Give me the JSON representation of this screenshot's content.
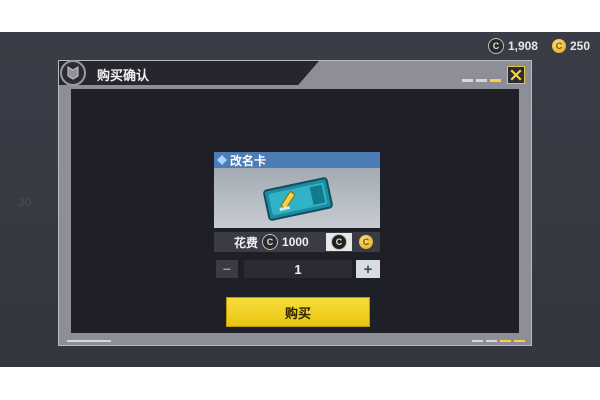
{
  "currency": {
    "cp_amount": "1,908",
    "gold_amount": "250"
  },
  "dialog": {
    "title": "购买确认",
    "item_name": "改名卡",
    "price_label": "花费",
    "price_value": "1000",
    "quantity": "1",
    "buy_label": "购买"
  },
  "background": {
    "ghost_value": "30"
  },
  "icons": {
    "cp_coin": "C",
    "gold_coin": "C",
    "minus": "−",
    "plus": "+"
  },
  "colors": {
    "accent_yellow": "#f2d34c",
    "item_header_blue": "#4b7cb3",
    "dialog_bg": "#1e1f27"
  }
}
